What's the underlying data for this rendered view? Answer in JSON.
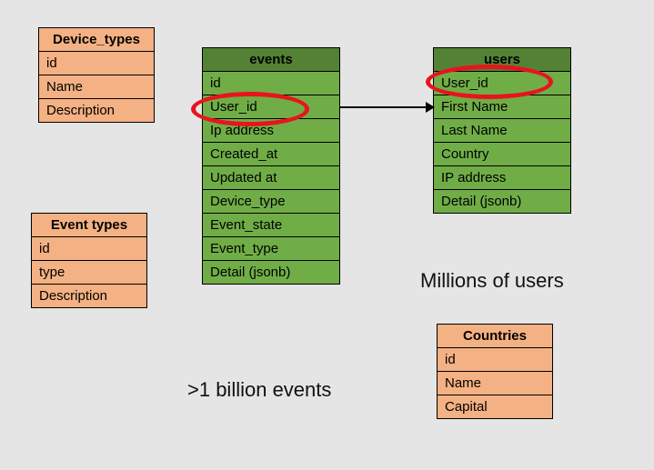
{
  "tables": {
    "device_types": {
      "title": "Device_types",
      "cols": [
        "id",
        "Name",
        "Description"
      ]
    },
    "event_types": {
      "title": "Event types",
      "cols": [
        "id",
        "type",
        "Description"
      ]
    },
    "events": {
      "title": "events",
      "cols": [
        "id",
        "User_id",
        "Ip address",
        "Created_at",
        "Updated at",
        "Device_type",
        "Event_state",
        "Event_type",
        "Detail (jsonb)"
      ]
    },
    "users": {
      "title": "users",
      "cols": [
        "User_id",
        "First Name",
        "Last Name",
        "Country",
        "IP address",
        "Detail (jsonb)"
      ]
    },
    "countries": {
      "title": "Countries",
      "cols": [
        "id",
        "Name",
        "Capital"
      ]
    }
  },
  "captions": {
    "events": ">1 billion events",
    "users": "Millions of users"
  },
  "relations": [
    {
      "from": "events.User_id",
      "to": "users.User_id"
    }
  ],
  "highlights": [
    "events.User_id",
    "users.User_id"
  ]
}
